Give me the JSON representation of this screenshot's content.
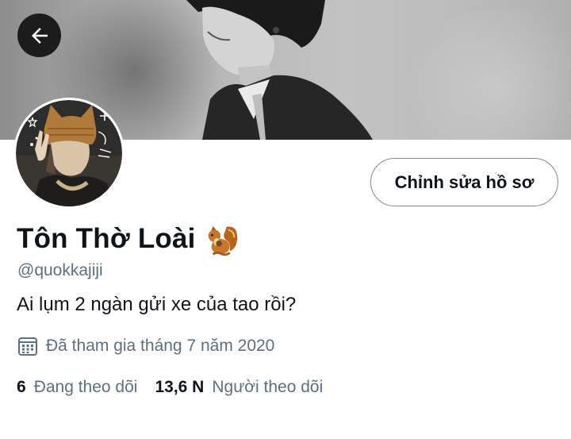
{
  "profile": {
    "display_name": "Tôn Thờ Loài",
    "handle": "@quokkajiji",
    "bio": "Ai lụm 2 ngàn gửi xe của tao rồi?",
    "joined": "Đã tham gia tháng 7 năm 2020"
  },
  "actions": {
    "edit_profile": "Chỉnh sửa hồ sơ"
  },
  "stats": {
    "following_count": "6",
    "following_label": "Đang theo dõi",
    "followers_count": "13,6 N",
    "followers_label": "Người theo dõi"
  },
  "icons": {
    "back": "arrow-left-icon",
    "name_emoji": "squirrel-emoji",
    "calendar": "calendar-icon"
  },
  "colors": {
    "text_primary": "#0f1419",
    "text_secondary": "#5b7083",
    "button_border": "#7b8a95"
  }
}
